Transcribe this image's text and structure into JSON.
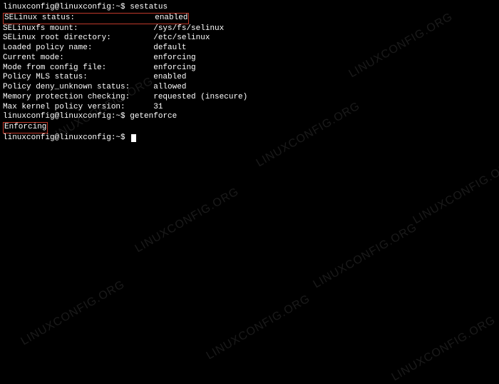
{
  "prompt1": "linuxconfig@linuxconfig:~$ ",
  "cmd1": "sestatus",
  "status_label": "SELinux status:",
  "status_value": "enabled",
  "rows": [
    {
      "label": "SELinuxfs mount:",
      "value": "/sys/fs/selinux"
    },
    {
      "label": "SELinux root directory:",
      "value": "/etc/selinux"
    },
    {
      "label": "Loaded policy name:",
      "value": "default"
    },
    {
      "label": "Current mode:",
      "value": "enforcing"
    },
    {
      "label": "Mode from config file:",
      "value": "enforcing"
    },
    {
      "label": "Policy MLS status:",
      "value": "enabled"
    },
    {
      "label": "Policy deny_unknown status:",
      "value": "allowed"
    },
    {
      "label": "Memory protection checking:",
      "value": "requested (insecure)"
    },
    {
      "label": "Max kernel policy version:",
      "value": "31"
    }
  ],
  "prompt2": "linuxconfig@linuxconfig:~$ ",
  "cmd2": "getenforce",
  "output2": "Enforcing",
  "prompt3": "linuxconfig@linuxconfig:~$ ",
  "watermark": "LINUXCONFIG.ORG",
  "label_width": 32
}
